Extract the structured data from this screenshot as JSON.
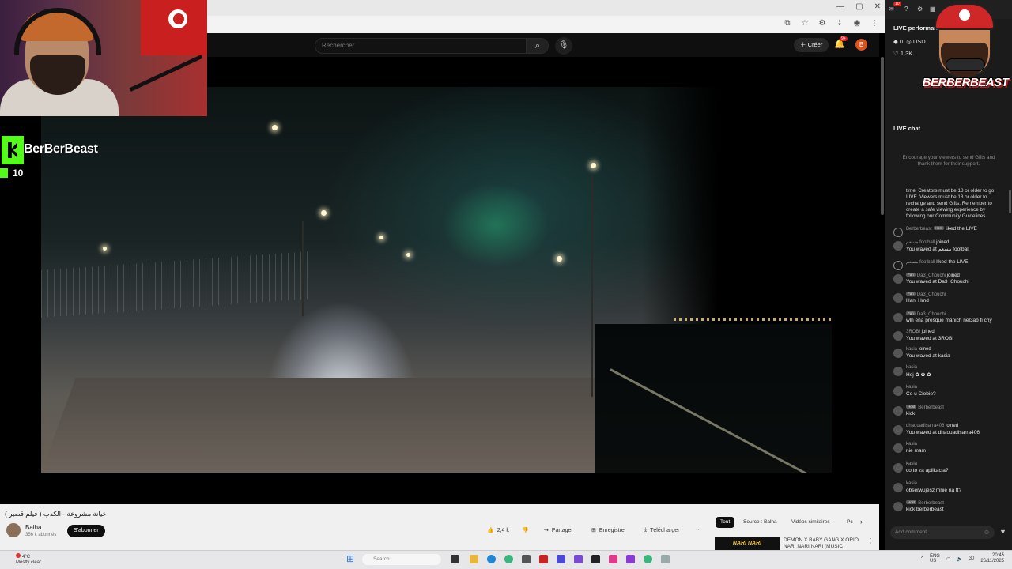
{
  "browser": {
    "window_controls": [
      "—",
      "▢",
      "✕"
    ]
  },
  "youtube": {
    "search_placeholder": "Rechercher",
    "create_label": "Créer",
    "notif_count": "9+",
    "avatar_letter": "B"
  },
  "video": {
    "title": "خيانة مشروعة - الكذب ( فيلم قصير )",
    "channel": "Balha",
    "subscribers": "356 k abonnés",
    "subscribe_label": "S'abonner",
    "likes": "2,4 k",
    "share_label": "Partager",
    "save_label": "Enregistrer",
    "download_label": "Télécharger",
    "more_label": "···",
    "chips": [
      "Tout",
      "Source : Balha",
      "Vidéos similaires",
      "Pc"
    ],
    "rec_thumb_text": "NARI NARI",
    "rec_title": "DEMON X BABY GANG X ORIO NARI NARI NARI (MUSIC"
  },
  "taskbar": {
    "weather_temp": "4°C",
    "weather_desc": "Mostly clear",
    "search_placeholder": "Search",
    "lang": "ENG",
    "lang2": "US",
    "time": "20:45",
    "date": "26/11/2025",
    "notif_badge": "30"
  },
  "overlay": {
    "kick_name": "BerBerBeast",
    "kick_count": "10",
    "brand_name": "BERBERBEAST"
  },
  "panel": {
    "top_badge": "10",
    "perf_title": "LIVE performance",
    "coins": "0",
    "usd": "USD",
    "likes": "1.3K",
    "live_chat_title": "LIVE chat",
    "encourage": "Encourage your viewers to send Gifts and thank them for their support.",
    "guidelines": "time. Creators must be 18 or older to go LIVE. Viewers must be 18 or older to recharge and send Gifts. Remember to create a safe viewing experience by following our Community Guidelines.",
    "add_comment": "Add comment",
    "messages": [
      {
        "type": "inline",
        "user": "Berberbeast",
        "badge": "Host",
        "text": "liked the LIVE"
      },
      {
        "type": "two",
        "user": "مسعم football",
        "user_suffix": "joined",
        "text": "You waved at مسعم football"
      },
      {
        "type": "inline",
        "user": "مسعم football",
        "badge": "",
        "text": "liked the LIVE"
      },
      {
        "type": "two",
        "user": "Da3_Chouchi",
        "badge": "Fan",
        "user_suffix": "joined",
        "text": "You waved at Da3_Chouchi"
      },
      {
        "type": "two",
        "user": "Da3_Chouchi",
        "badge": "Fan",
        "user_suffix": "",
        "text": "Hani Hmd"
      },
      {
        "type": "two",
        "user": "Da3_Chouchi",
        "badge": "Fan",
        "user_suffix": "",
        "text": "wlh ena presque manich nel3ab fi chy"
      },
      {
        "type": "two",
        "user": "3ROBI",
        "user_suffix": "joined",
        "text": "You waved at 3ROBI"
      },
      {
        "type": "two",
        "user": "kasia",
        "user_suffix": "joined",
        "text": "You waved at kasia"
      },
      {
        "type": "two",
        "user": "kasia",
        "user_suffix": "",
        "text": "Hej ✿ ✿ ✿"
      },
      {
        "type": "two",
        "user": "kasia",
        "user_suffix": "",
        "text": "Co u Ciebie?"
      },
      {
        "type": "two",
        "user": "Berberbeast",
        "badge": "Host",
        "user_suffix": "",
        "text": "kick"
      },
      {
        "type": "two",
        "user": "dhaouadisarra406",
        "user_suffix": "joined",
        "text": "You waved at dhaouadisarra406"
      },
      {
        "type": "two",
        "user": "kasia",
        "user_suffix": "",
        "text": "nie mam"
      },
      {
        "type": "two",
        "user": "kasia",
        "user_suffix": "",
        "text": "co to za aplikacja?"
      },
      {
        "type": "two",
        "user": "kasia",
        "user_suffix": "",
        "text": "obserwujesz mnie na tt?"
      },
      {
        "type": "two",
        "user": "Berberbeast",
        "badge": "Host",
        "user_suffix": "",
        "text": "kick berberbeast"
      }
    ]
  }
}
